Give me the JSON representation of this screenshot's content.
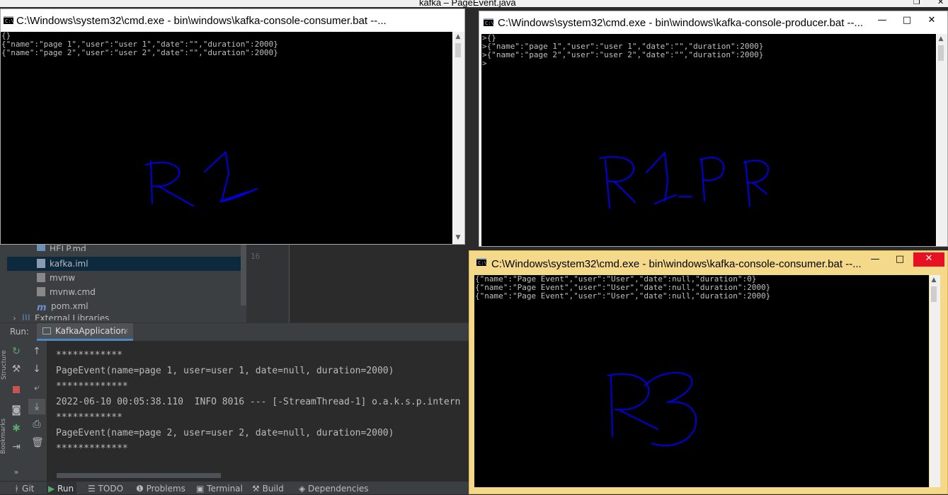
{
  "ide": {
    "window_title": "kafka – PageEvent.java",
    "project_files": [
      "HELP.md",
      "kafka.iml",
      "mvnw",
      "mvnw.cmd",
      "pom.xml",
      "External Libraries"
    ],
    "gutter_line": "16",
    "side_labels": [
      "Structure",
      "Bookmarks"
    ],
    "run_label": "Run:",
    "run_tab": "KafkaApplication",
    "console_lines": [
      "************",
      "PageEvent(name=page 1, user=user 1, date=null, duration=2000)",
      "*************",
      "2022-06-10 00:05:38.110  INFO 8016 --- [-StreamThread-1] o.a.k.s.p.intern",
      "************",
      "PageEvent(name=page 2, user=user 2, date=null, duration=2000)",
      "*************"
    ],
    "status_tabs": [
      "Git",
      "Run",
      "TODO",
      "Problems",
      "Terminal",
      "Build",
      "Dependencies"
    ]
  },
  "windows": {
    "consumer1": {
      "title": "C:\\Windows\\system32\\cmd.exe - bin\\windows\\kafka-console-consumer.bat   --...",
      "lines": "{}\n{\"name\":\"page 1\",\"user\":\"user 1\",\"date\":\"\",\"duration\":2000}\n{\"name\":\"page 2\",\"user\":\"user 2\",\"date\":\"\",\"duration\":2000}",
      "scribble": "R1"
    },
    "producer": {
      "title": "C:\\Windows\\system32\\cmd.exe - bin\\windows\\kafka-console-producer.bat   --...",
      "lines": ">{}\n>{\"name\":\"page 1\",\"user\":\"user 1\",\"date\":\"\",\"duration\":2000}\n>{\"name\":\"page 2\",\"user\":\"user 2\",\"date\":\"\",\"duration\":2000}\n>",
      "scribble": "R1_PR"
    },
    "consumer3": {
      "title": "C:\\Windows\\system32\\cmd.exe - bin\\windows\\kafka-console-consumer.bat   --...",
      "lines": "{\"name\":\"Page Event\",\"user\":\"User\",\"date\":null,\"duration\":0}\n{\"name\":\"Page Event\",\"user\":\"User\",\"date\":null,\"duration\":2000}\n{\"name\":\"Page Event\",\"user\":\"User\",\"date\":null,\"duration\":2000}",
      "scribble": "R3"
    }
  },
  "colors": {
    "scribble": "#0000e0",
    "active_frame": "#f5d98b",
    "ide_bg": "#2b2b2b",
    "close_red": "#e81123"
  }
}
